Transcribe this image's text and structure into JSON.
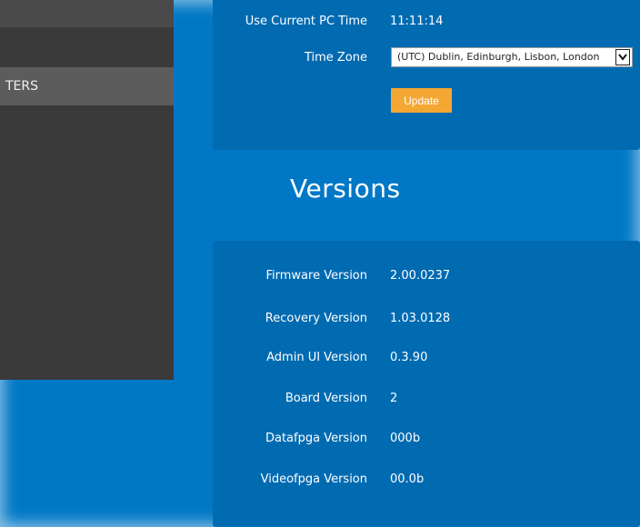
{
  "sidebar": {
    "items": [
      {
        "label": ""
      },
      {
        "label": ""
      },
      {
        "label": "TERS"
      }
    ]
  },
  "time_settings": {
    "current_pc_time_label": "Use Current PC Time",
    "current_pc_time_value": "11:11:14",
    "time_zone_label": "Time Zone",
    "time_zone_value": "(UTC) Dublin, Edinburgh, Lisbon, London",
    "update_button": "Update"
  },
  "versions": {
    "heading": "Versions",
    "rows": [
      {
        "label": "Firmware Version",
        "value": "2.00.0237"
      },
      {
        "label": "Recovery Version",
        "value": "1.03.0128"
      },
      {
        "label": "Admin UI Version",
        "value": "0.3.90"
      },
      {
        "label": "Board Version",
        "value": "2"
      },
      {
        "label": "Datafpga Version",
        "value": "000b"
      },
      {
        "label": "Videofpga Version",
        "value": "00.0b"
      }
    ]
  },
  "colors": {
    "background": "#0178c6",
    "panel": "#016bb2",
    "sidebar": "#3a3a3a",
    "accent_button": "#f5a733"
  }
}
